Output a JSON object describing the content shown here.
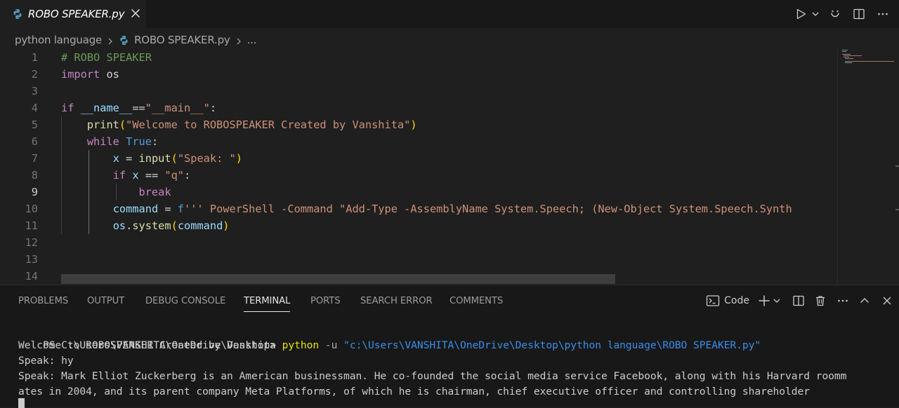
{
  "tab": {
    "title": "ROBO SPEAKER.py"
  },
  "breadcrumb": {
    "folder": "python language",
    "file": "ROBO SPEAKER.py",
    "more": "..."
  },
  "editor": {
    "line_numbers": [
      "1",
      "2",
      "3",
      "4",
      "5",
      "6",
      "7",
      "8",
      "9",
      "10",
      "11",
      "12",
      "13",
      "14"
    ],
    "lines": [
      [
        {
          "t": "# ROBO SPEAKER",
          "c": "comment"
        }
      ],
      [
        {
          "t": "import",
          "c": "kw"
        },
        {
          "t": " os",
          "c": "plain"
        }
      ],
      [],
      [
        {
          "t": "if",
          "c": "kw"
        },
        {
          "t": " __name__",
          "c": "var"
        },
        {
          "t": "==",
          "c": "op"
        },
        {
          "t": "\"__main__\"",
          "c": "str"
        },
        {
          "t": ":",
          "c": "plain"
        }
      ],
      [
        {
          "t": "    ",
          "c": "plain"
        },
        {
          "t": "print",
          "c": "fn"
        },
        {
          "t": "(",
          "c": "paren"
        },
        {
          "t": "\"Welcome to ROBOSPEAKER Created by Vanshita\"",
          "c": "str"
        },
        {
          "t": ")",
          "c": "paren"
        }
      ],
      [
        {
          "t": "    ",
          "c": "plain"
        },
        {
          "t": "while",
          "c": "kw"
        },
        {
          "t": " ",
          "c": "plain"
        },
        {
          "t": "True",
          "c": "const"
        },
        {
          "t": ":",
          "c": "plain"
        }
      ],
      [
        {
          "t": "        ",
          "c": "plain"
        },
        {
          "t": "x",
          "c": "var"
        },
        {
          "t": " = ",
          "c": "op"
        },
        {
          "t": "input",
          "c": "fn"
        },
        {
          "t": "(",
          "c": "paren"
        },
        {
          "t": "\"Speak: \"",
          "c": "str"
        },
        {
          "t": ")",
          "c": "paren"
        }
      ],
      [
        {
          "t": "        ",
          "c": "plain"
        },
        {
          "t": "if",
          "c": "kw"
        },
        {
          "t": " x",
          "c": "var"
        },
        {
          "t": " == ",
          "c": "op"
        },
        {
          "t": "\"q\"",
          "c": "str"
        },
        {
          "t": ":",
          "c": "plain"
        }
      ],
      [
        {
          "t": "            ",
          "c": "plain"
        },
        {
          "t": "break",
          "c": "kw"
        }
      ],
      [
        {
          "t": "        ",
          "c": "plain"
        },
        {
          "t": "command",
          "c": "var"
        },
        {
          "t": " = ",
          "c": "op"
        },
        {
          "t": "f",
          "c": "const"
        },
        {
          "t": "''' PowerShell -Command \"Add-Type -AssemblyName System.Speech; (New-Object System.Speech.Synth",
          "c": "str"
        }
      ],
      [
        {
          "t": "        ",
          "c": "plain"
        },
        {
          "t": "os",
          "c": "var"
        },
        {
          "t": ".",
          "c": "plain"
        },
        {
          "t": "system",
          "c": "fn"
        },
        {
          "t": "(",
          "c": "paren"
        },
        {
          "t": "command",
          "c": "var"
        },
        {
          "t": ")",
          "c": "paren"
        }
      ],
      [],
      [],
      []
    ]
  },
  "panel": {
    "tabs": [
      "PROBLEMS",
      "OUTPUT",
      "DEBUG CONSOLE",
      "TERMINAL",
      "PORTS",
      "SEARCH ERROR",
      "COMMENTS"
    ],
    "active_tab": "TERMINAL",
    "terminal_profile": "Code"
  },
  "terminal": {
    "prompt": "PS C:\\Users\\VANSHITA\\OneDrive\\Desktop> ",
    "cmd": "python",
    "flag": " -u ",
    "path": "\"c:\\Users\\VANSHITA\\OneDrive\\Desktop\\python language\\ROBO SPEAKER.py\"",
    "lines": [
      "Welcome to ROBOSPEAKER Created by Vanshita",
      "Speak: hy",
      "Speak: Mark Elliot Zuckerberg is an American businessman. He co-founded the social media service Facebook, along with his Harvard roomm",
      "ates in 2004, and its parent company Meta Platforms, of which he is chairman, chief executive officer and controlling shareholder"
    ]
  }
}
